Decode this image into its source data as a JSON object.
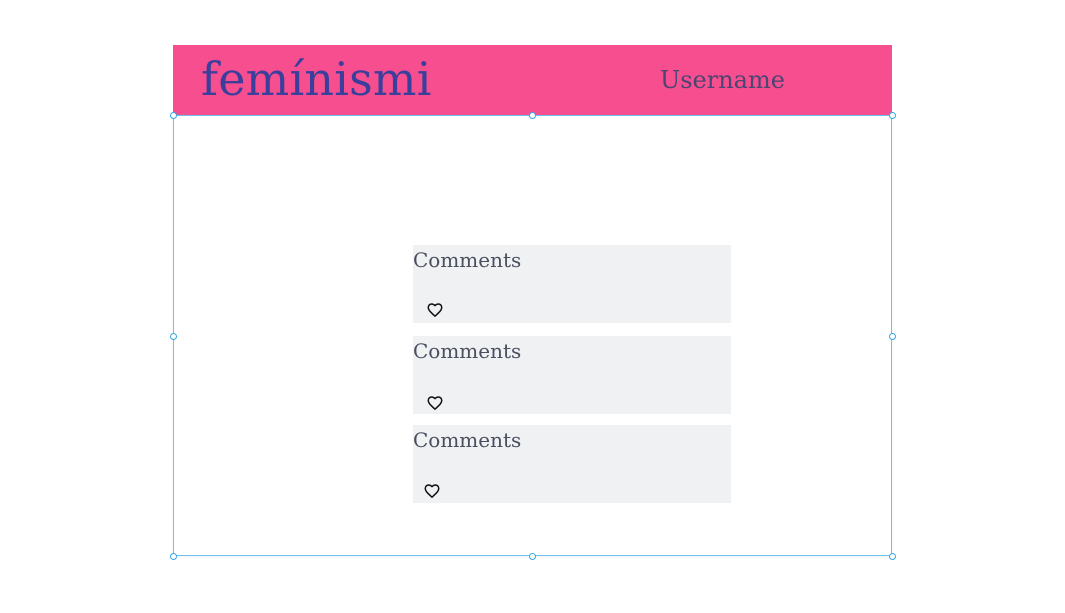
{
  "header": {
    "brand": "femínismi",
    "username": "Username"
  },
  "comments": [
    {
      "label": "Comments",
      "icon": "heart-icon"
    },
    {
      "label": "Comments",
      "icon": "heart-icon"
    },
    {
      "label": "Comments",
      "icon": "heart-icon"
    }
  ],
  "colors": {
    "header": "#f74e8f",
    "brand": "#3b3f9c",
    "username": "#4a4572",
    "card": "#f0f1f3",
    "selection": "#6cc3ee"
  }
}
